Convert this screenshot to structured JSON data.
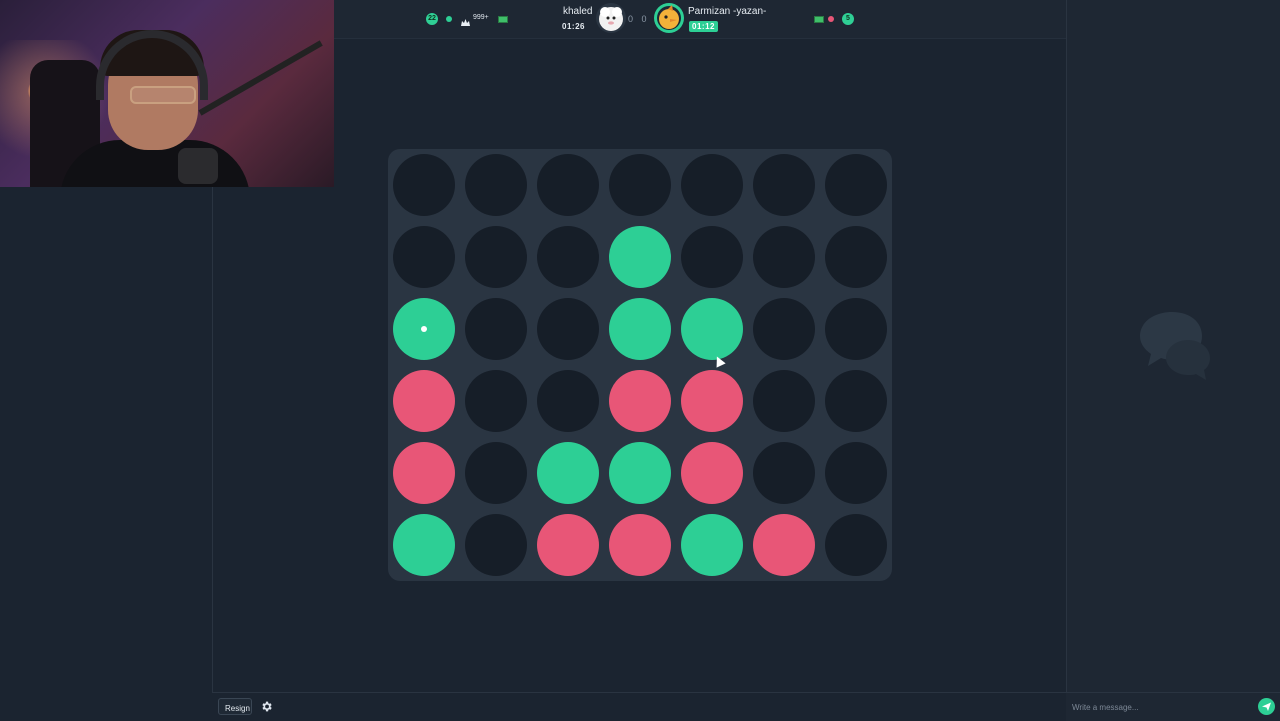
{
  "header": {
    "left_player": {
      "name": "khaled",
      "timer": "01:26",
      "rating_badge": "22",
      "crown_label": "999+",
      "status_dot_color": "#2dcf95",
      "avatar_icon": "sheep-avatar"
    },
    "right_player": {
      "name": "Parmizan -yazan-",
      "timer": "01:12",
      "rating_badge": "5",
      "status_dot_color": "#e85677",
      "avatar_icon": "bird-avatar"
    },
    "score": "0 0"
  },
  "board": {
    "rows": 6,
    "columns": 7,
    "cells": [
      [
        "empty",
        "empty",
        "empty",
        "empty",
        "empty",
        "empty",
        "empty"
      ],
      [
        "empty",
        "empty",
        "empty",
        "green",
        "empty",
        "empty",
        "empty"
      ],
      [
        "green",
        "empty",
        "empty",
        "green",
        "green",
        "empty",
        "empty"
      ],
      [
        "red",
        "empty",
        "empty",
        "red",
        "red",
        "empty",
        "empty"
      ],
      [
        "red",
        "empty",
        "green",
        "green",
        "red",
        "empty",
        "empty"
      ],
      [
        "green",
        "empty",
        "red",
        "red",
        "green",
        "red",
        "empty"
      ]
    ],
    "last_move": {
      "row": 2,
      "col": 0
    },
    "colors": {
      "green": "#2dcf95",
      "red": "#e85677",
      "empty": "#161e28",
      "board": "#2a3542"
    }
  },
  "controls": {
    "resign_label": "Resign",
    "settings_icon": "gear-icon"
  },
  "chat": {
    "placeholder": "Write a message...",
    "empty_icon": "chat-bubbles-icon",
    "emoji_icon": "emoji-icon",
    "send_icon": "send-icon"
  }
}
